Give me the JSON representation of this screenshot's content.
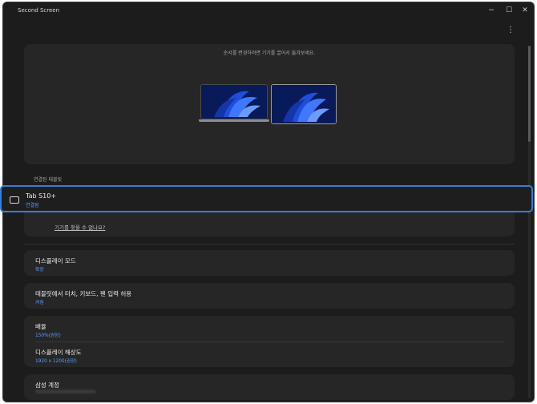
{
  "window": {
    "title": "Second Screen"
  },
  "controls": {
    "minimize": "−",
    "maximize": "☐",
    "close": "✕",
    "more": "⋮"
  },
  "arrange": {
    "hint": "순서를 변경하려면 기기를 끌어서 옮겨보세요."
  },
  "connected": {
    "section_label": "연결된 태블릿",
    "device_name": "Tab S10+",
    "device_status": "연결됨",
    "not_found_link": "기기를 찾을 수 없나요?"
  },
  "settings": {
    "display_mode": {
      "title": "디스플레이 모드",
      "value": "확장"
    },
    "input": {
      "title": "태블릿에서 터치, 키보드, 펜 입력 허용",
      "value": "켜짐"
    },
    "scale": {
      "title": "배율",
      "value": "150%(권장)"
    },
    "resolution": {
      "title": "디스플레이 해상도",
      "value": "1920 x 1200(권장)"
    },
    "account": {
      "title": "삼성 계정"
    }
  },
  "colors": {
    "accent": "#2f7fe0",
    "link": "#5aa0ff",
    "background": "#1c1c1c",
    "card": "#262626"
  }
}
